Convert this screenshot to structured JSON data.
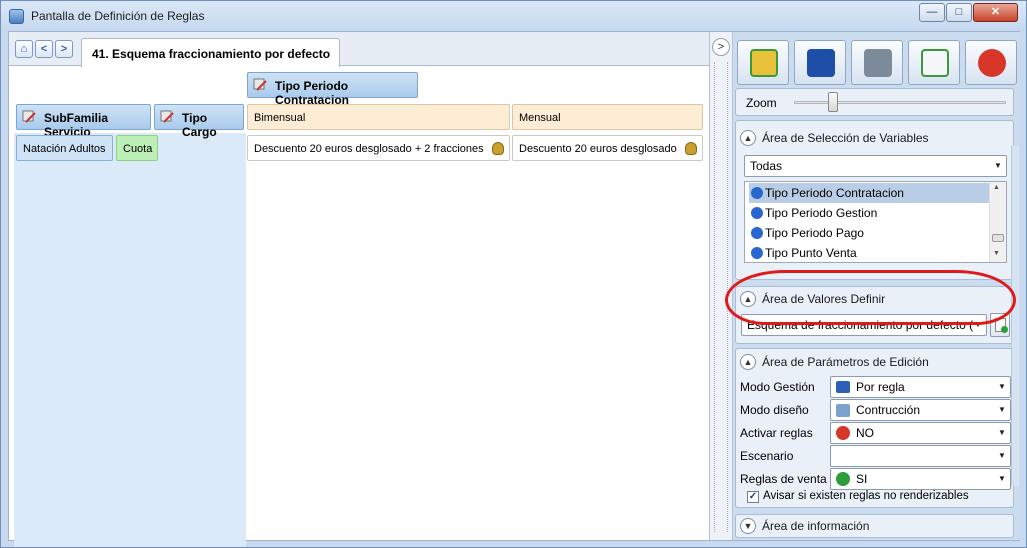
{
  "window": {
    "title": "Pantalla de Definición de Reglas",
    "buttons": {
      "minimize": "—",
      "maximize": "□",
      "close": "✕"
    }
  },
  "tabs": {
    "nav_home": "⌂",
    "nav_back": "<",
    "nav_forward": ">",
    "active_tab": "41. Esquema fraccionamiento por defecto"
  },
  "grid": {
    "column_header": "Tipo Periodo Contratacion",
    "row_headers": [
      "SubFamilia Servicio",
      "Tipo Cargo"
    ],
    "columns": [
      "Bimensual",
      "Mensual"
    ],
    "rows": [
      {
        "keys": [
          "Natación Adultos",
          "Cuota"
        ],
        "values": [
          "Descuento 20 euros desglosado + 2 fracciones",
          "Descuento 20 euros desglosado"
        ]
      }
    ]
  },
  "splitter": {
    "toggle": ">"
  },
  "toolbar": {
    "icons": [
      "open-folder-icon",
      "save-icon",
      "print-icon",
      "export-icon",
      "close-icon"
    ],
    "accent_colors": {
      "open": "#e7c23a",
      "save": "#1e4fa8",
      "print": "#7d8a99",
      "export": "#3a9a3a",
      "close": "#d9362a"
    }
  },
  "zoom": {
    "label": "Zoom",
    "level_fraction": 0.2
  },
  "seleccion": {
    "title": "Área de Selección de Variables",
    "filter_value": "Todas",
    "variables": [
      "Tipo Periodo Contratacion",
      "Tipo Periodo Gestion",
      "Tipo Periodo Pago",
      "Tipo Punto Venta"
    ],
    "selected_index": 0
  },
  "valores": {
    "title": "Área de Valores Definir",
    "selected_value": "Esquema de fraccionamiento por defecto (",
    "highlight_color": "#e0191b"
  },
  "parametros": {
    "title": "Área de Parámetros de Edición",
    "fields": [
      {
        "label": "Modo Gestión",
        "value": "Por regla",
        "icon": "book-icon"
      },
      {
        "label": "Modo diseño",
        "value": "Contrucción",
        "icon": "design-icon"
      },
      {
        "label": "Activar reglas",
        "value": "NO",
        "icon": "red-x-icon"
      },
      {
        "label": "Escenario",
        "value": "",
        "icon": ""
      },
      {
        "label": "Reglas de venta",
        "value": "SI",
        "icon": "green-check-icon"
      }
    ],
    "checkbox_label": "Avisar si existen reglas no renderizables",
    "checkbox_checked": true
  },
  "informacion": {
    "title": "Área de información"
  }
}
